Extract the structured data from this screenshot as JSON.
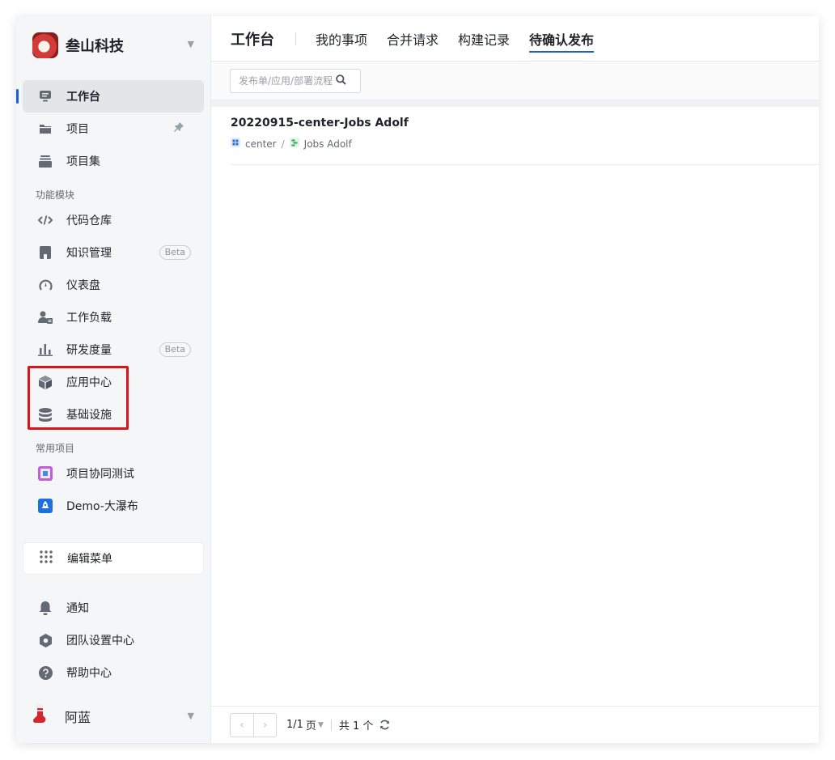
{
  "team": {
    "name": "叁山科技",
    "caret": "▼"
  },
  "nav": {
    "workbench": "工作台",
    "projects": "项目",
    "project_sets": "项目集"
  },
  "sections": {
    "modules": "功能模块",
    "frequent": "常用项目"
  },
  "modules": {
    "code_repo": "代码仓库",
    "knowledge": "知识管理",
    "dashboard": "仪表盘",
    "workload": "工作负载",
    "metrics": "研发度量",
    "app_center": "应用中心",
    "infrastructure": "基础设施",
    "beta_label": "Beta"
  },
  "frequent_projects": {
    "p1": "项目协同测试",
    "p2": "Demo-大瀑布"
  },
  "edit_menu": "编辑菜单",
  "bottom_nav": {
    "notifications": "通知",
    "team_settings": "团队设置中心",
    "help": "帮助中心"
  },
  "user": {
    "name": "阿蓝",
    "caret": "▼"
  },
  "header": {
    "title": "工作台",
    "tabs": [
      "我的事项",
      "合并请求",
      "构建记录",
      "待确认发布"
    ],
    "active_tab": "待确认发布"
  },
  "search": {
    "placeholder": "发布单/应用/部署流程"
  },
  "list": [
    {
      "title": "20220915-center-Jobs Adolf",
      "app": "center",
      "separator": "/",
      "pipeline": "Jobs Adolf"
    }
  ],
  "pagination": {
    "prev": "‹",
    "next": "›",
    "current": "1/1",
    "unit": "页",
    "caret": "▼",
    "total": "共 1 个"
  },
  "colors": {
    "accent": "#1d5fd6",
    "highlight_box": "#d4161d"
  }
}
